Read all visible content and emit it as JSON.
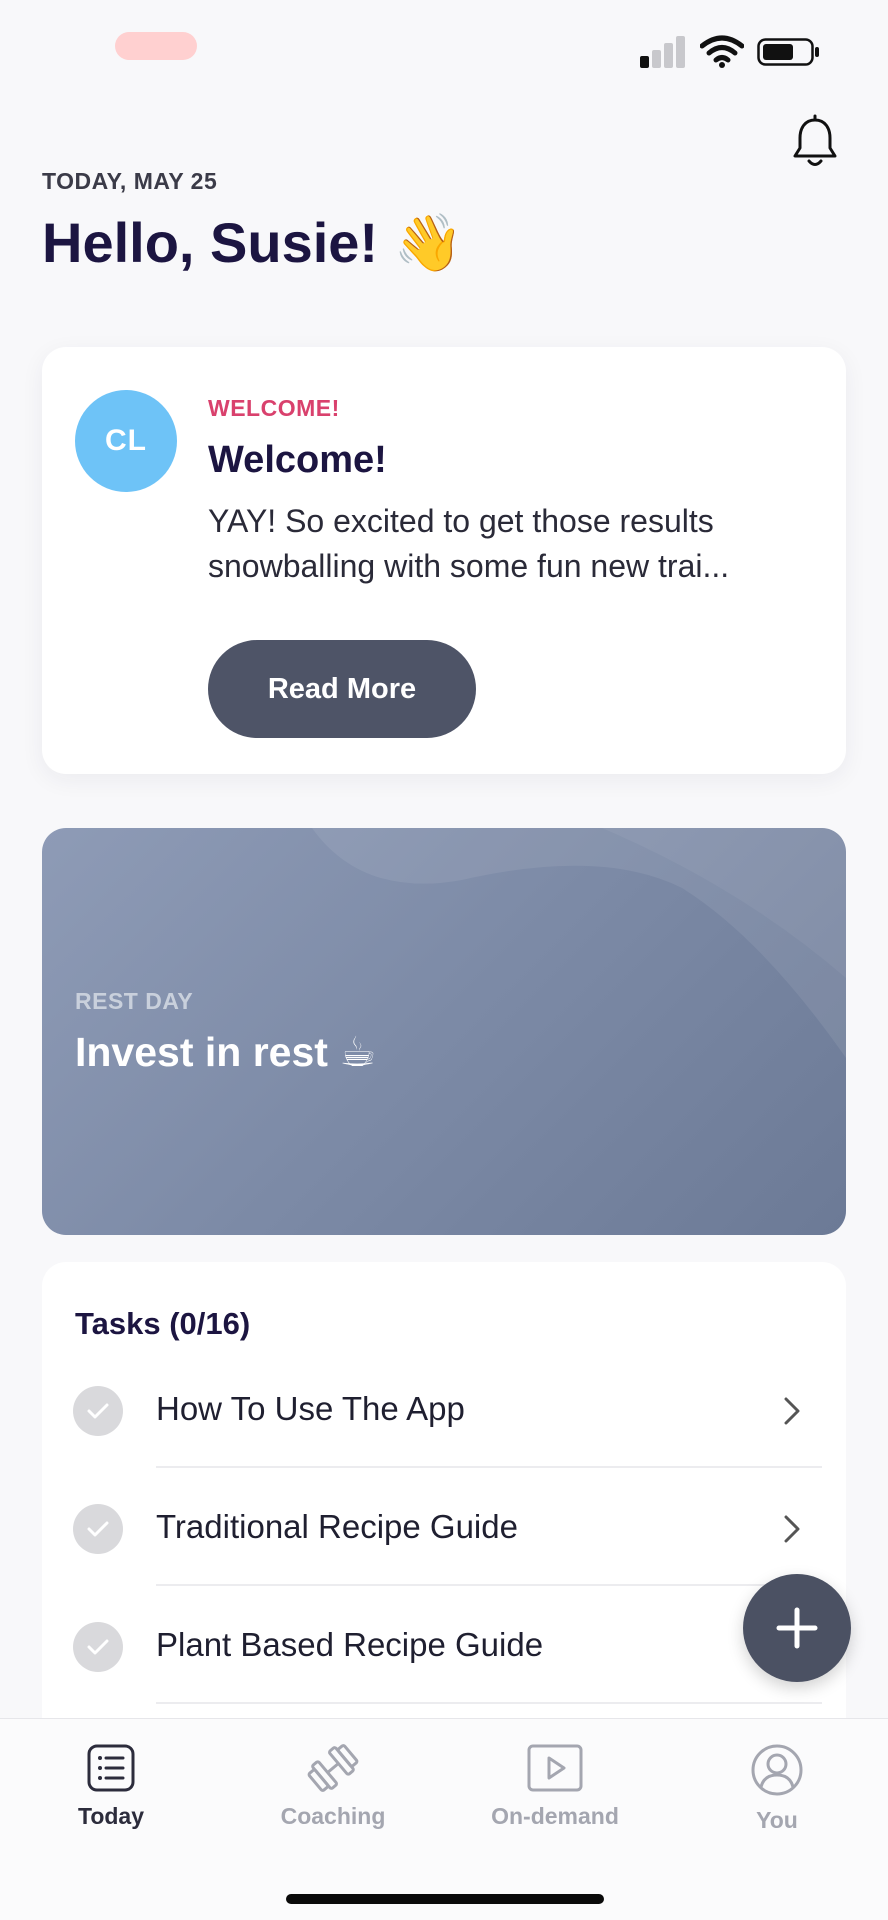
{
  "status_bar": {
    "recording_indicator": "red-pill",
    "signal_icon": "cellular-signal-icon",
    "wifi_icon": "wifi-icon",
    "battery_icon": "battery-icon",
    "signal_bars_active": 1,
    "signal_bars_total": 4
  },
  "header": {
    "date": "TODAY, MAY 25",
    "greeting": "Hello, Susie! 👋",
    "bell_icon": "bell-icon"
  },
  "welcome_card": {
    "avatar_initials": "CL",
    "avatar_color": "#6ec3f7",
    "kicker": "WELCOME!",
    "kicker_color": "#d9416d",
    "title": "Welcome!",
    "body": "YAY! So excited to get those results snowballing with some fun new trai...",
    "button_label": "Read More"
  },
  "rest_card": {
    "kicker": "REST DAY",
    "title": "Invest in rest ☕"
  },
  "tasks": {
    "title": "Tasks (0/16)",
    "items": [
      {
        "label": "How To Use The App",
        "done": false
      },
      {
        "label": "Traditional Recipe Guide",
        "done": false
      },
      {
        "label": "Plant Based Recipe Guide",
        "done": false
      }
    ]
  },
  "fab": {
    "icon": "plus-icon"
  },
  "bottom_nav": {
    "items": [
      {
        "label": "Today",
        "icon": "list-icon",
        "active": true
      },
      {
        "label": "Coaching",
        "icon": "dumbbell-icon",
        "active": false
      },
      {
        "label": "On-demand",
        "icon": "play-icon",
        "active": false
      },
      {
        "label": "You",
        "icon": "user-icon",
        "active": false
      }
    ]
  },
  "colors": {
    "primary_text": "#1c1541",
    "button_dark": "#4e5467",
    "nav_inactive": "#a4a6b0"
  }
}
